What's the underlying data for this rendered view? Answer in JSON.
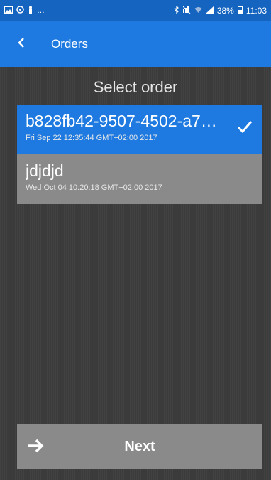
{
  "status_bar": {
    "left_icons": [
      "image-icon",
      "circle-icon",
      "person-icon"
    ],
    "ellipsis": "…",
    "battery": "38%",
    "time": "11:03"
  },
  "app_bar": {
    "title": "Orders",
    "back_icon": "chevron-left-icon"
  },
  "main": {
    "title": "Select order",
    "orders": [
      {
        "name": "b828fb42-9507-4502-a7…",
        "date": "Fri Sep 22 12:35:44 GMT+02:00 2017",
        "selected": true
      },
      {
        "name": "jdjdjd",
        "date": "Wed Oct 04 10:20:18 GMT+02:00 2017",
        "selected": false
      }
    ],
    "next_label": "Next"
  },
  "colors": {
    "status_bar": "#1565c0",
    "app_bar": "#1e7ae0",
    "selected_item": "#1e7ae0",
    "unselected_item": "#8a8a8a",
    "background": "#3b3b3b"
  }
}
